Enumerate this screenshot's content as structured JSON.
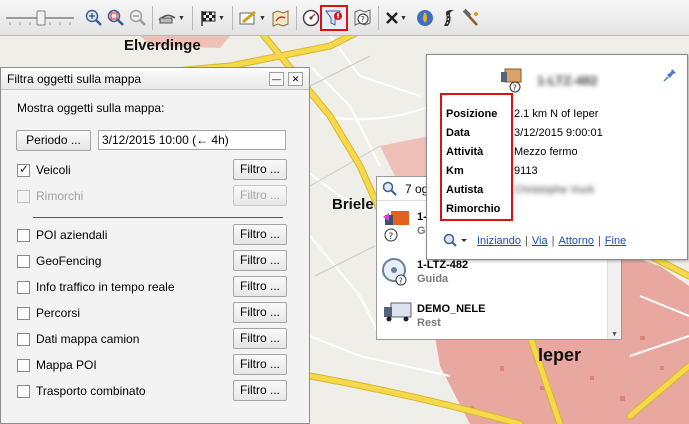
{
  "toolbar": {
    "items": [
      {
        "icon": "zoom-slider"
      },
      {
        "icon": "zoom-in-icon"
      },
      {
        "icon": "zoom-area-icon"
      },
      {
        "icon": "zoom-out-icon"
      },
      {
        "icon": "truck-route-icon"
      },
      {
        "icon": "checkered-flag-icon"
      },
      {
        "icon": "edit-map-icon"
      },
      {
        "icon": "map-layers-icon"
      },
      {
        "icon": "speedometer-icon"
      },
      {
        "icon": "filter-map-icon",
        "active": true
      },
      {
        "icon": "help-map-icon"
      },
      {
        "icon": "close-x-icon"
      },
      {
        "icon": "fuel-drop-icon"
      },
      {
        "icon": "road-icon"
      },
      {
        "icon": "hammer-icon"
      }
    ]
  },
  "map": {
    "places": [
      {
        "name": "Elverdinge"
      },
      {
        "name": "Briele"
      },
      {
        "name": "Ieper"
      }
    ],
    "colors": {
      "background": "#efeee9",
      "road_major": "#f6d94a",
      "road_minor": "#ffffff",
      "urban": "#e8a8a0",
      "urban_dots": "#d9847b"
    }
  },
  "filter_panel": {
    "title": "Filtra oggetti sulla mappa",
    "show_label": "Mostra oggetti sulla mappa:",
    "period_button": "Periodo ...",
    "period_value": "3/12/2015 10:00 (← 4h)",
    "filter_label": "Filtro ...",
    "options": [
      {
        "label": "Veicoli",
        "checked": true,
        "enabled": true
      },
      {
        "label": "Rimorchi",
        "checked": false,
        "enabled": false
      },
      {
        "label": "POI aziendali",
        "checked": false,
        "enabled": true
      },
      {
        "label": "GeoFencing",
        "checked": false,
        "enabled": true
      },
      {
        "label": "Info traffico in tempo reale",
        "checked": false,
        "enabled": true
      },
      {
        "label": "Percorsi",
        "checked": false,
        "enabled": true
      },
      {
        "label": "Dati mappa camion",
        "checked": false,
        "enabled": true
      },
      {
        "label": "Mappa POI",
        "checked": false,
        "enabled": true
      },
      {
        "label": "Trasporto combinato",
        "checked": false,
        "enabled": true
      }
    ]
  },
  "vehicle_list": {
    "header": "7 og",
    "items": [
      {
        "name": "1-",
        "status": "Guid"
      },
      {
        "name": "1-LTZ-482",
        "status": "Guida"
      },
      {
        "name": "DEMO_NELE",
        "status": "Rest"
      }
    ]
  },
  "info_popup": {
    "vehicle_id": "1-LTZ-482",
    "fields": [
      {
        "key": "Posizione",
        "value": "2.1 km N of Ieper"
      },
      {
        "key": "Data",
        "value": "3/12/2015 9:00:01"
      },
      {
        "key": "Attività",
        "value": "Mezzo fermo"
      },
      {
        "key": "Km",
        "value": "9113"
      },
      {
        "key": "Autista",
        "value": "Christophe Vuck"
      },
      {
        "key": "Rimorchio",
        "value": ""
      }
    ],
    "links": [
      "Iniziando",
      "Via",
      "Attorno",
      "Fine"
    ]
  }
}
